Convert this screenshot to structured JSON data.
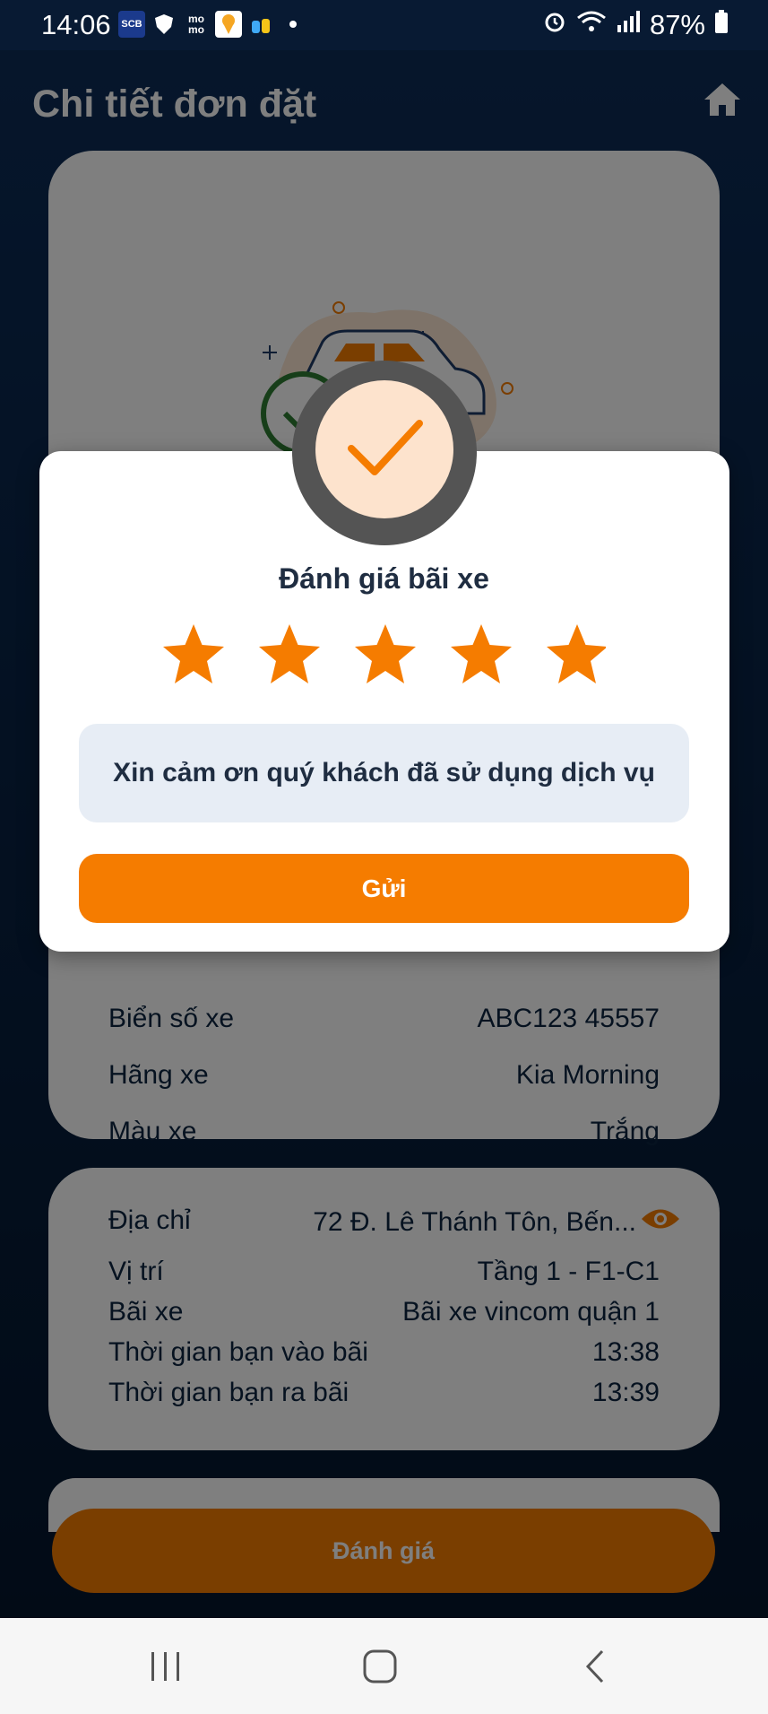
{
  "status_bar": {
    "time": "14:06",
    "battery": "87%",
    "icons": [
      "scb-icon",
      "shield-icon",
      "momo-icon",
      "map-pin-app-icon",
      "family-app-icon",
      "dot-icon",
      "alarm-icon",
      "wifi-icon",
      "signal-icon",
      "battery-icon"
    ]
  },
  "header": {
    "title": "Chi tiết đơn đặt",
    "home_icon": "home-icon"
  },
  "vehicle": {
    "rows": [
      {
        "label": "Biển số xe",
        "value": "ABC123 45557"
      },
      {
        "label": "Hãng xe",
        "value": "Kia Morning"
      },
      {
        "label": "Màu xe",
        "value": "Trắng"
      }
    ]
  },
  "parking": {
    "rows": [
      {
        "label": "Địa chỉ",
        "value": "72 Đ. Lê Thánh Tôn, Bến..."
      },
      {
        "label": "Vị trí",
        "value": "Tầng 1 - F1-C1"
      },
      {
        "label": "Bãi xe",
        "value": "Bãi xe vincom quận 1"
      },
      {
        "label": "Thời gian bạn vào bãi",
        "value": "13:38"
      },
      {
        "label": "Thời gian bạn ra bãi",
        "value": "13:39"
      }
    ]
  },
  "bottom_button": "Đánh giá",
  "dialog": {
    "title": "Đánh giá bãi xe",
    "rating": 5,
    "max_rating": 5,
    "message": "Xin cảm ơn quý khách đã sử dụng dịch vụ",
    "submit_label": "Gửi"
  },
  "colors": {
    "accent": "#f57c00",
    "app_bg": "#0c2c57",
    "dialog_msg_bg": "#e7edf5"
  }
}
